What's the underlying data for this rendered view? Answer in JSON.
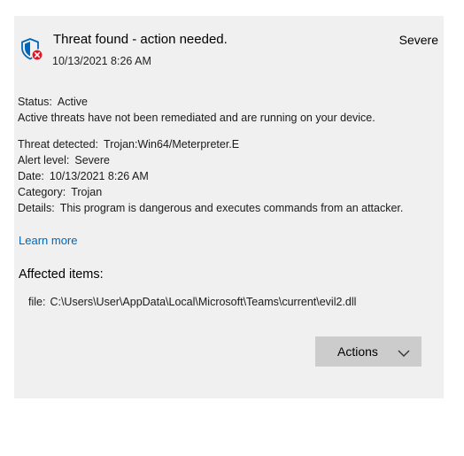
{
  "threat": {
    "title": "Threat found - action needed.",
    "date": "10/13/2021 8:26 AM",
    "severity": "Severe",
    "icon": "shield-error-icon"
  },
  "status": {
    "label": "Status:",
    "value": "Active",
    "description": "Active threats have not been remediated and are running on your device."
  },
  "details": {
    "threat_detected_label": "Threat detected:",
    "threat_detected_value": "Trojan:Win64/Meterpreter.E",
    "alert_level_label": "Alert level:",
    "alert_level_value": "Severe",
    "date_label": "Date:",
    "date_value": "10/13/2021 8:26 AM",
    "category_label": "Category:",
    "category_value": "Trojan",
    "details_label": "Details:",
    "details_value": "This program is dangerous and executes commands from an attacker."
  },
  "learn_more": "Learn more",
  "affected": {
    "heading": "Affected items:",
    "file_label": "file:",
    "file_path": "C:\\Users\\User\\AppData\\Local\\Microsoft\\Teams\\current\\evil2.dll"
  },
  "actions": {
    "label": "Actions"
  },
  "colors": {
    "panel_background": "#f0f0f0",
    "link": "#0067b8",
    "shield": "#0067b8",
    "error_badge": "#e81123",
    "button": "#cccccc"
  }
}
